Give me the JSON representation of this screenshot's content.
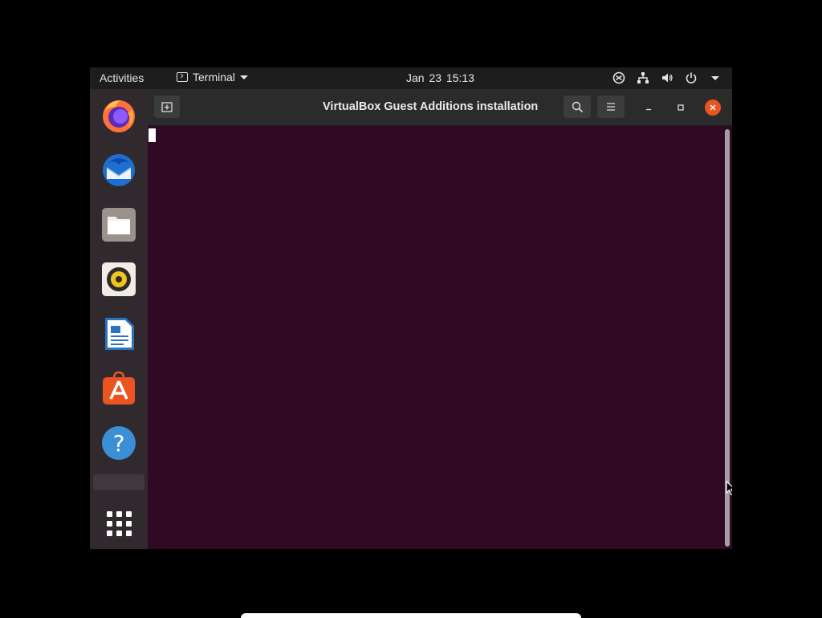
{
  "top_panel": {
    "activities_label": "Activities",
    "app_menu_label": "Terminal",
    "clock": "Jan 23  15:13",
    "tray_icons": [
      "accessibility-icon",
      "network-icon",
      "volume-icon",
      "power-icon",
      "chevron-down-icon"
    ]
  },
  "dock": {
    "items": [
      "Firefox",
      "Thunderbird",
      "Files",
      "Rhythmbox",
      "LibreOffice Writer",
      "Ubuntu Software",
      "Help"
    ],
    "show_apps_icon": "grid-icon"
  },
  "window": {
    "title": "VirtualBox Guest Additions installation",
    "buttons": [
      "new-tab-icon",
      "search-icon",
      "hamburger-menu-icon",
      "minimize-icon",
      "maximize-icon",
      "close-icon"
    ]
  },
  "colors": {
    "terminal_bg": "#300a24",
    "accent": "#e95420",
    "panel_bg": "#1d1d1d",
    "dock_bg": "#302a2e"
  }
}
